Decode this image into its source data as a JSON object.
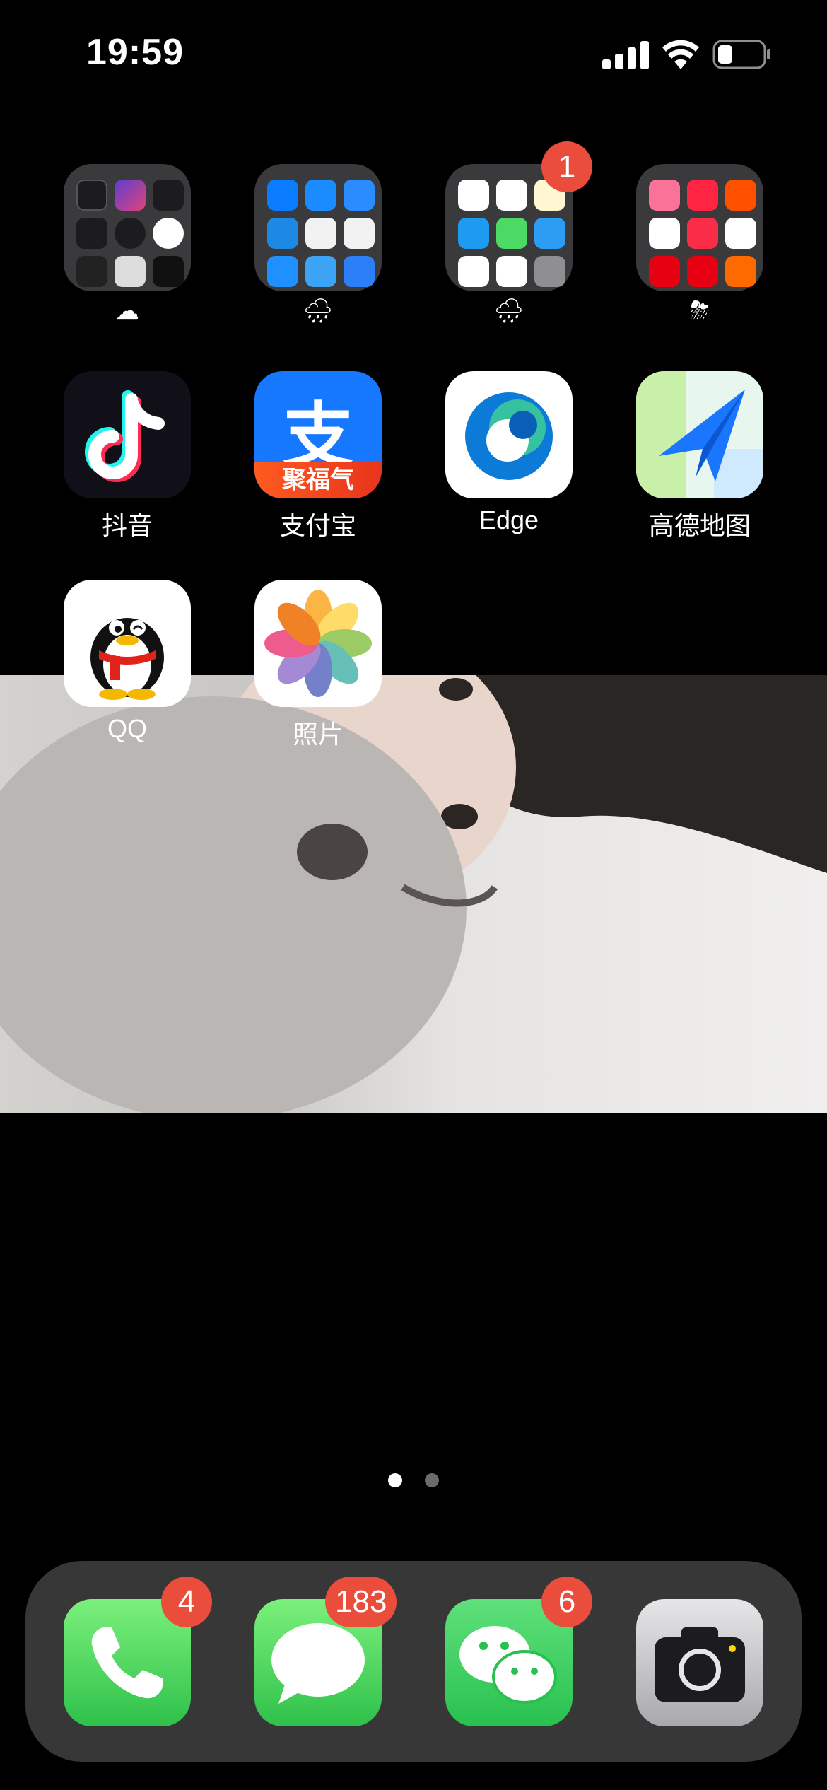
{
  "status_bar": {
    "time": "19:59"
  },
  "folders": [
    {
      "badge": "",
      "weather": "☁"
    },
    {
      "badge": "",
      "weather": "🌧"
    },
    {
      "badge": "1",
      "weather": "🌧"
    },
    {
      "badge": "",
      "weather": "⛈"
    }
  ],
  "apps": [
    {
      "label": "抖音",
      "icon": "tiktok-icon"
    },
    {
      "label": "支付宝",
      "icon": "alipay-icon",
      "banner": "聚福气",
      "glyph": "支"
    },
    {
      "label": "Edge",
      "icon": "edge-icon"
    },
    {
      "label": "高德地图",
      "icon": "amap-icon"
    },
    {
      "label": "QQ",
      "icon": "qq-icon"
    },
    {
      "label": "照片",
      "icon": "photos-icon"
    }
  ],
  "page_indicator": {
    "pages": 2,
    "current": 1
  },
  "dock": [
    {
      "name": "phone",
      "badge": "4"
    },
    {
      "name": "messages",
      "badge": "183"
    },
    {
      "name": "wechat",
      "badge": "6"
    },
    {
      "name": "camera",
      "badge": ""
    }
  ],
  "colors": {
    "badge": "#eb4d3d",
    "folder_bg": "#3a3a3c",
    "alipay_blue": "#1677ff",
    "green_app": "#4cd964"
  }
}
